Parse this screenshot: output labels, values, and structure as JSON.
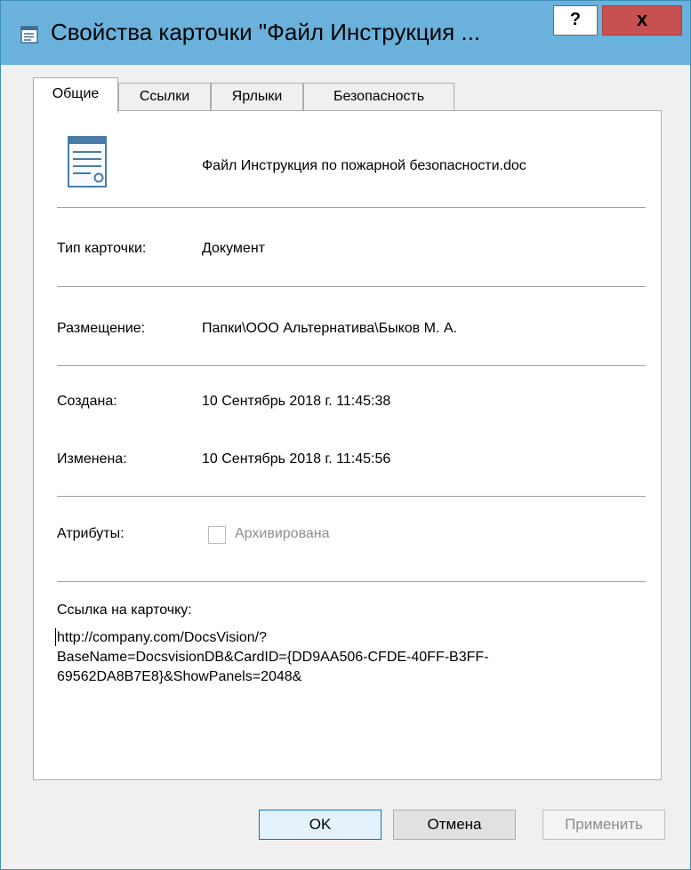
{
  "window": {
    "title": "Свойства карточки \"Файл Инструкция ...",
    "help_label": "?",
    "close_label": "x"
  },
  "tabs": [
    {
      "label": "Общие",
      "active": true
    },
    {
      "label": "Ссылки",
      "active": false
    },
    {
      "label": "Ярлыки",
      "active": false
    },
    {
      "label": "Безопасность",
      "active": false
    }
  ],
  "general": {
    "filename": "Файл Инструкция по пожарной безопасности.doc",
    "card_type_label": "Тип карточки:",
    "card_type_value": "Документ",
    "location_label": "Размещение:",
    "location_value": "Папки\\ООО Альтернатива\\Быков М. А.",
    "created_label": "Создана:",
    "created_value": "10 Сентябрь 2018 г. 11:45:38",
    "modified_label": "Изменена:",
    "modified_value": "10 Сентябрь 2018 г. 11:45:56",
    "attributes_label": "Атрибуты:",
    "archived_label": "Архивирована",
    "archived_checked": false,
    "link_label": "Ссылка на карточку:",
    "link_value": "http://company.com/DocsVision/?\nBaseName=DocsvisionDB&CardID={DD9AA506-CFDE-40FF-B3FF-\n69562DA8B7E8}&ShowPanels=2048&"
  },
  "buttons": {
    "ok": "OK",
    "cancel": "Отмена",
    "apply": "Применить"
  },
  "colors": {
    "titlebar": "#6ab2dc",
    "close_button": "#c75050",
    "default_button_border": "#0078d7",
    "disabled_text": "#8d8d8d"
  },
  "icons": {
    "title": "properties-icon",
    "document": "document-icon"
  }
}
